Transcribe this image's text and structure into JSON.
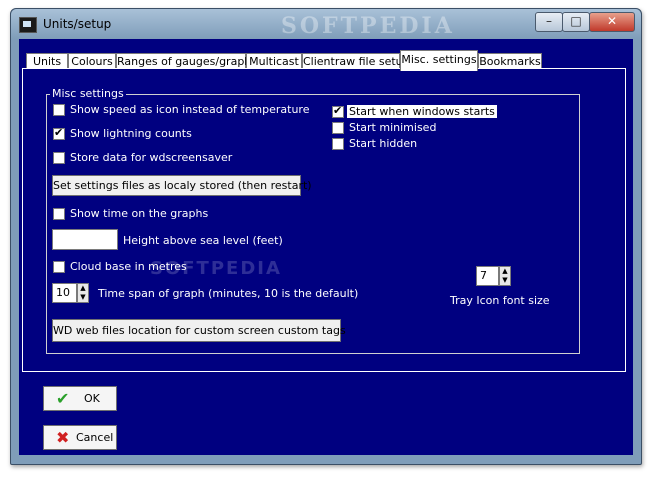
{
  "window": {
    "title": "Units/setup",
    "watermark": "SOFTPEDIA",
    "controls": {
      "minimize": "–",
      "maximize": "□",
      "close": "✕"
    }
  },
  "tabs": [
    "Units",
    "Colours",
    "Ranges of gauges/graph",
    "Multicast",
    "Clientraw file setup",
    "Misc. settings",
    "Bookmarks"
  ],
  "active_tab": "Misc. settings",
  "misc": {
    "group_title": "Misc settings",
    "show_speed_icon": {
      "label": "Show speed as icon instead of temperature",
      "checked": false
    },
    "show_lightning": {
      "label": "Show lightning counts",
      "checked": true
    },
    "store_data": {
      "label": "Store data for wdscreensaver",
      "checked": false
    },
    "set_settings_button": "Set settings files as localy stored (then restart)",
    "show_time_graphs": {
      "label": "Show time on the graphs",
      "checked": false
    },
    "height_label": "Height above sea level (feet)",
    "height_value": "",
    "cloud_base": {
      "label": "Cloud base in metres",
      "checked": false
    },
    "time_span_value": "10",
    "time_span_label": "Time span of graph (minutes, 10 is the default)",
    "wd_files_button": "WD web files location for custom screen custom tags",
    "start_windows": {
      "label": "Start when windows starts",
      "checked": true
    },
    "start_minimised": {
      "label": "Start minimised",
      "checked": false
    },
    "start_hidden": {
      "label": "Start hidden",
      "checked": false
    },
    "tray_font_value": "7",
    "tray_font_label": "Tray Icon font size"
  },
  "buttons": {
    "ok": "OK",
    "cancel": "Cancel"
  }
}
